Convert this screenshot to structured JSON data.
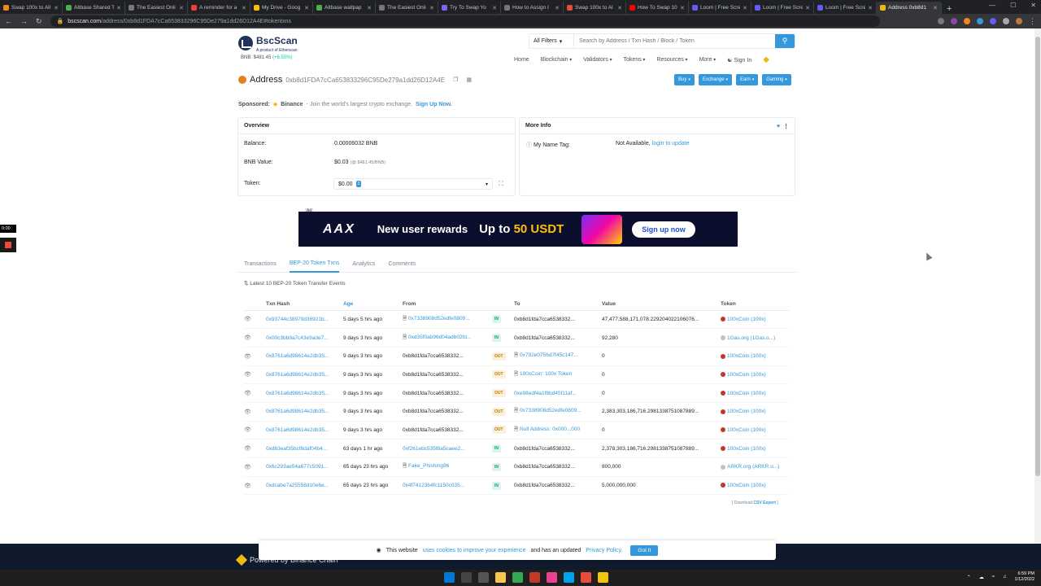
{
  "browser": {
    "tabs": [
      {
        "title": "Swap 100x to All",
        "color": "#f6851b"
      },
      {
        "title": "Altbase Shared T",
        "color": "#4caf50"
      },
      {
        "title": "The Easiest Onli",
        "color": "#777777"
      },
      {
        "title": "A reminder for a",
        "color": "#ea4335"
      },
      {
        "title": "My Drive - Goog",
        "color": "#fbbc04"
      },
      {
        "title": "Altbase wallpap",
        "color": "#4caf50"
      },
      {
        "title": "The Easiest Onli",
        "color": "#777777"
      },
      {
        "title": "Try To Swap Yo",
        "color": "#7b68ee"
      },
      {
        "title": "How to Assign I",
        "color": "#777777"
      },
      {
        "title": "Swap 100x to Al",
        "color": "#e74c3c"
      },
      {
        "title": "How To Swap 10",
        "color": "#ff0000"
      },
      {
        "title": "Loom | Free Scre",
        "color": "#625df5"
      },
      {
        "title": "Loom | Free Scre",
        "color": "#625df5"
      },
      {
        "title": "Loom | Free Scre",
        "color": "#625df5"
      },
      {
        "title": "Address 0xb8d1",
        "color": "#f0b90b",
        "active": true
      }
    ],
    "url_host": "bscscan.com",
    "url_path": "/address/0xb8d1FDA7cCa653833296C95De279a1dd26D12A4E#tokentxns"
  },
  "header": {
    "logo_name": "BscScan",
    "logo_sub": "A product of Etherscan",
    "bnb_price": "BNB: $481.45",
    "bnb_change": "(+6.50%)",
    "filter_label": "All Filters",
    "search_placeholder": "Search by Address / Txn Hash / Block / Token",
    "nav": [
      "Home",
      "Blockchain",
      "Validators",
      "Tokens",
      "Resources",
      "More"
    ],
    "signin": "Sign In"
  },
  "address": {
    "title": "Address",
    "hash": "0xb8d1FDA7cCa653833296C95De279a1dd26D12A4E",
    "buttons": [
      "Buy",
      "Exchange",
      "Earn",
      "Gaming"
    ]
  },
  "sponsored": {
    "label": "Sponsored:",
    "brand": "Binance",
    "text": "- Join the world's largest crypto exchange.",
    "cta": "Sign Up Now."
  },
  "overview": {
    "title": "Overview",
    "balance_label": "Balance:",
    "balance_value": "0.00006032 BNB",
    "bnb_value_label": "BNB Value:",
    "bnb_value": "$0.03",
    "bnb_value_note": "(@ $481.45/BNB)",
    "token_label": "Token:",
    "token_value": "$0.00",
    "token_count": "3"
  },
  "moreinfo": {
    "title": "More Info",
    "tag_label": "My Name Tag:",
    "tag_value": "Not Available,",
    "tag_link": "login to update"
  },
  "ad": {
    "tag": "Ad",
    "brand": "AAX",
    "message": "New user rewards",
    "amount_prefix": "Up to",
    "amount": "50 USDT",
    "cta": "Sign up now"
  },
  "tabs": [
    "Transactions",
    "BEP-20 Token Txns",
    "Analytics",
    "Comments"
  ],
  "tx_caption": "Latest 10 BEP-20 Token Transfer Events",
  "table": {
    "headers": [
      "Txn Hash",
      "Age",
      "From",
      "To",
      "Value",
      "Token"
    ],
    "rows": [
      {
        "hash": "0x93744c38979d36921b...",
        "age": "5 days 5 hrs ago",
        "from": "0x7338908d52edfe0809...",
        "from_link": true,
        "from_contract": true,
        "dir": "IN",
        "to": "0xb8d1fda7cca6538332...",
        "to_link": false,
        "to_contract": false,
        "value": "47,477,588,171,078.229204022106076...",
        "token": "100xCoin (100x)",
        "token_grey": false
      },
      {
        "hash": "0x00c3bb9a7c43e9ade7...",
        "age": "9 days 3 hrs ago",
        "from": "0xd35f0ab96d04adb02fd...",
        "from_link": true,
        "from_contract": true,
        "dir": "IN",
        "to": "0xb8d1fda7cca6538332...",
        "to_link": false,
        "to_contract": false,
        "value": "92,280",
        "token": "1Gas.org (1Gas.o...)",
        "token_grey": true
      },
      {
        "hash": "0x8761a6d98614e2db35...",
        "age": "9 days 3 hrs ago",
        "from": "0xb8d1fda7cca6538332...",
        "from_link": false,
        "from_contract": false,
        "dir": "OUT",
        "to": "0x792e0756d7f45c147...",
        "to_link": true,
        "to_contract": true,
        "value": "0",
        "token": "100xCoin (100x)",
        "token_grey": false
      },
      {
        "hash": "0x8761a6d98614e2db35...",
        "age": "9 days 3 hrs ago",
        "from": "0xb8d1fda7cca6538332...",
        "from_link": false,
        "from_contract": false,
        "dir": "OUT",
        "to": "100xCoin: 100x Token",
        "to_link": true,
        "to_contract": true,
        "value": "0",
        "token": "100xCoin (100x)",
        "token_grey": false
      },
      {
        "hash": "0x8761a6d98614e2db35...",
        "age": "9 days 3 hrs ago",
        "from": "0xb8d1fda7cca6538332...",
        "from_link": false,
        "from_contract": false,
        "dir": "OUT",
        "to": "0xe98edf4a1f8bd45f11af...",
        "to_link": true,
        "to_contract": false,
        "value": "0",
        "token": "100xCoin (100x)",
        "token_grey": false
      },
      {
        "hash": "0x8761a6d98614e2db35...",
        "age": "9 days 3 hrs ago",
        "from": "0xb8d1fda7cca6538332...",
        "from_link": false,
        "from_contract": false,
        "dir": "OUT",
        "to": "0x7338908d52edfe0809...",
        "to_link": true,
        "to_contract": true,
        "value": "2,383,303,186,716.2981338751087889...",
        "token": "100xCoin (100x)",
        "token_grey": false
      },
      {
        "hash": "0x8761a6d98614e2db35...",
        "age": "9 days 3 hrs ago",
        "from": "0xb8d1fda7cca6538332...",
        "from_link": false,
        "from_contract": false,
        "dir": "OUT",
        "to": "Null Address: 0x000...000",
        "to_link": true,
        "to_contract": true,
        "value": "0",
        "token": "100xCoin (100x)",
        "token_grey": false
      },
      {
        "hash": "0xd63eaf35bcf8daf04b4...",
        "age": "63 days 1 hr ago",
        "from": "0xf261ebc535f8a5caee2...",
        "from_link": true,
        "from_contract": false,
        "dir": "IN",
        "to": "0xb8d1fda7cca6538332...",
        "to_link": false,
        "to_contract": false,
        "value": "2,378,303,186,716.2981338751087889...",
        "token": "100xCoin (100x)",
        "token_grey": false
      },
      {
        "hash": "0x6c293ae54a677c5091...",
        "age": "65 days 23 hrs ago",
        "from": "Fake_Phishing96",
        "from_link": true,
        "from_contract": true,
        "dir": "IN",
        "to": "0xb8d1fda7cca6538332...",
        "to_link": false,
        "to_contract": false,
        "value": "800,000",
        "token": "ARKR.org (ARKR.o...)",
        "token_grey": true
      },
      {
        "hash": "0xdcabe7a25558d10e6e...",
        "age": "65 days 23 hrs ago",
        "from": "0x4f74123b4fc1150c035...",
        "from_link": true,
        "from_contract": false,
        "dir": "IN",
        "to": "0xb8d1fda7cca6538332...",
        "to_link": false,
        "to_contract": false,
        "value": "5,000,000,000",
        "token": "100xCoin (100x)",
        "token_grey": false
      }
    ]
  },
  "csv": {
    "prefix": "[ Download",
    "link": "CSV Export",
    "suffix": "]"
  },
  "footer": {
    "powered": "Powered by Binance Chain"
  },
  "cookie": {
    "text1": "This website",
    "link1": "uses cookies to improve your experience",
    "text2": "and has an updated",
    "link2": "Privacy Policy.",
    "button": "Got It"
  },
  "recorder": {
    "time": "0:00"
  },
  "taskbar": {
    "time": "6:59 PM",
    "date": "1/12/2022"
  }
}
